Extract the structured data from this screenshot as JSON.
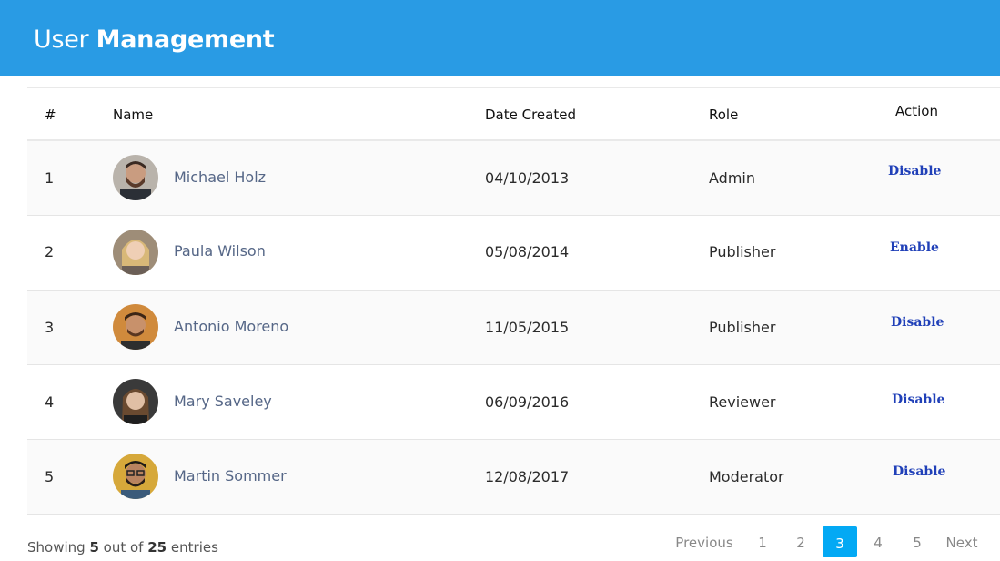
{
  "header": {
    "title_light": "User",
    "title_bold": "Management"
  },
  "table": {
    "columns": [
      "#",
      "Name",
      "Date Created",
      "Role",
      "Action"
    ],
    "rows": [
      {
        "num": "1",
        "name": "Michael Holz",
        "date": "04/10/2013",
        "role": "Admin",
        "action": "Disable"
      },
      {
        "num": "2",
        "name": "Paula Wilson",
        "date": "05/08/2014",
        "role": "Publisher",
        "action": "Enable"
      },
      {
        "num": "3",
        "name": "Antonio Moreno",
        "date": "11/05/2015",
        "role": "Publisher",
        "action": "Disable"
      },
      {
        "num": "4",
        "name": "Mary Saveley",
        "date": "06/09/2016",
        "role": "Reviewer",
        "action": "Disable"
      },
      {
        "num": "5",
        "name": "Martin Sommer",
        "date": "12/08/2017",
        "role": "Moderator",
        "action": "Disable"
      }
    ]
  },
  "footer": {
    "showing_prefix": "Showing",
    "shown": "5",
    "out_of": "out of",
    "total": "25",
    "entries": "entries"
  },
  "pagination": {
    "previous": "Previous",
    "pages": [
      "1",
      "2",
      "3",
      "4",
      "5"
    ],
    "current": "3",
    "next": "Next"
  },
  "colors": {
    "header": "#299be4",
    "active_page": "#03a9f4",
    "action_link": "#2040b8",
    "name_text": "#566787"
  }
}
